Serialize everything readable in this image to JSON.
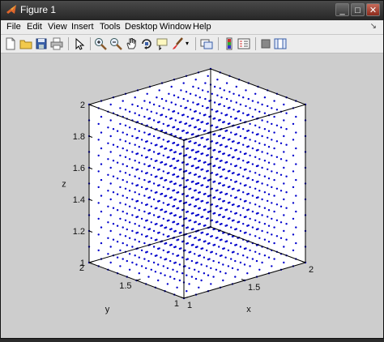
{
  "window": {
    "title": "Figure 1"
  },
  "title_buttons": [
    "_",
    "□",
    "✕"
  ],
  "menu": [
    "File",
    "Edit",
    "View",
    "Insert",
    "Tools",
    "Desktop",
    "Window",
    "Help"
  ],
  "toolbar": [
    "new-figure-icon",
    "open-file-icon",
    "save-icon",
    "print-icon",
    "edit-plot-icon",
    "zoom-in-icon",
    "zoom-out-icon",
    "pan-icon",
    "rotate-3d-icon",
    "data-cursor-icon",
    "brush-icon",
    "brush-menu-icon",
    "link-plot-icon",
    "colorbar-icon",
    "legend-icon",
    "hide-plot-tools-icon",
    "show-plot-tools-icon"
  ],
  "chart_data": {
    "type": "scatter",
    "projection": "3d",
    "xlabel": "x",
    "ylabel": "y",
    "zlabel": "z",
    "xlim": [
      1,
      2
    ],
    "ylim": [
      1,
      2
    ],
    "zlim": [
      1,
      2
    ],
    "xticks": [
      "1",
      "1.5",
      "2"
    ],
    "yticks": [
      "1",
      "1.5",
      "2"
    ],
    "zticks": [
      "1",
      "1.2",
      "1.4",
      "1.6",
      "1.8",
      "2"
    ],
    "grid": false,
    "box": true,
    "marker_color": "#0000cc",
    "grid_points_per_axis": 11,
    "points_desc": "11×11×11 lattice x,y,z ∈ {1.0,1.1,…,2.0}"
  }
}
